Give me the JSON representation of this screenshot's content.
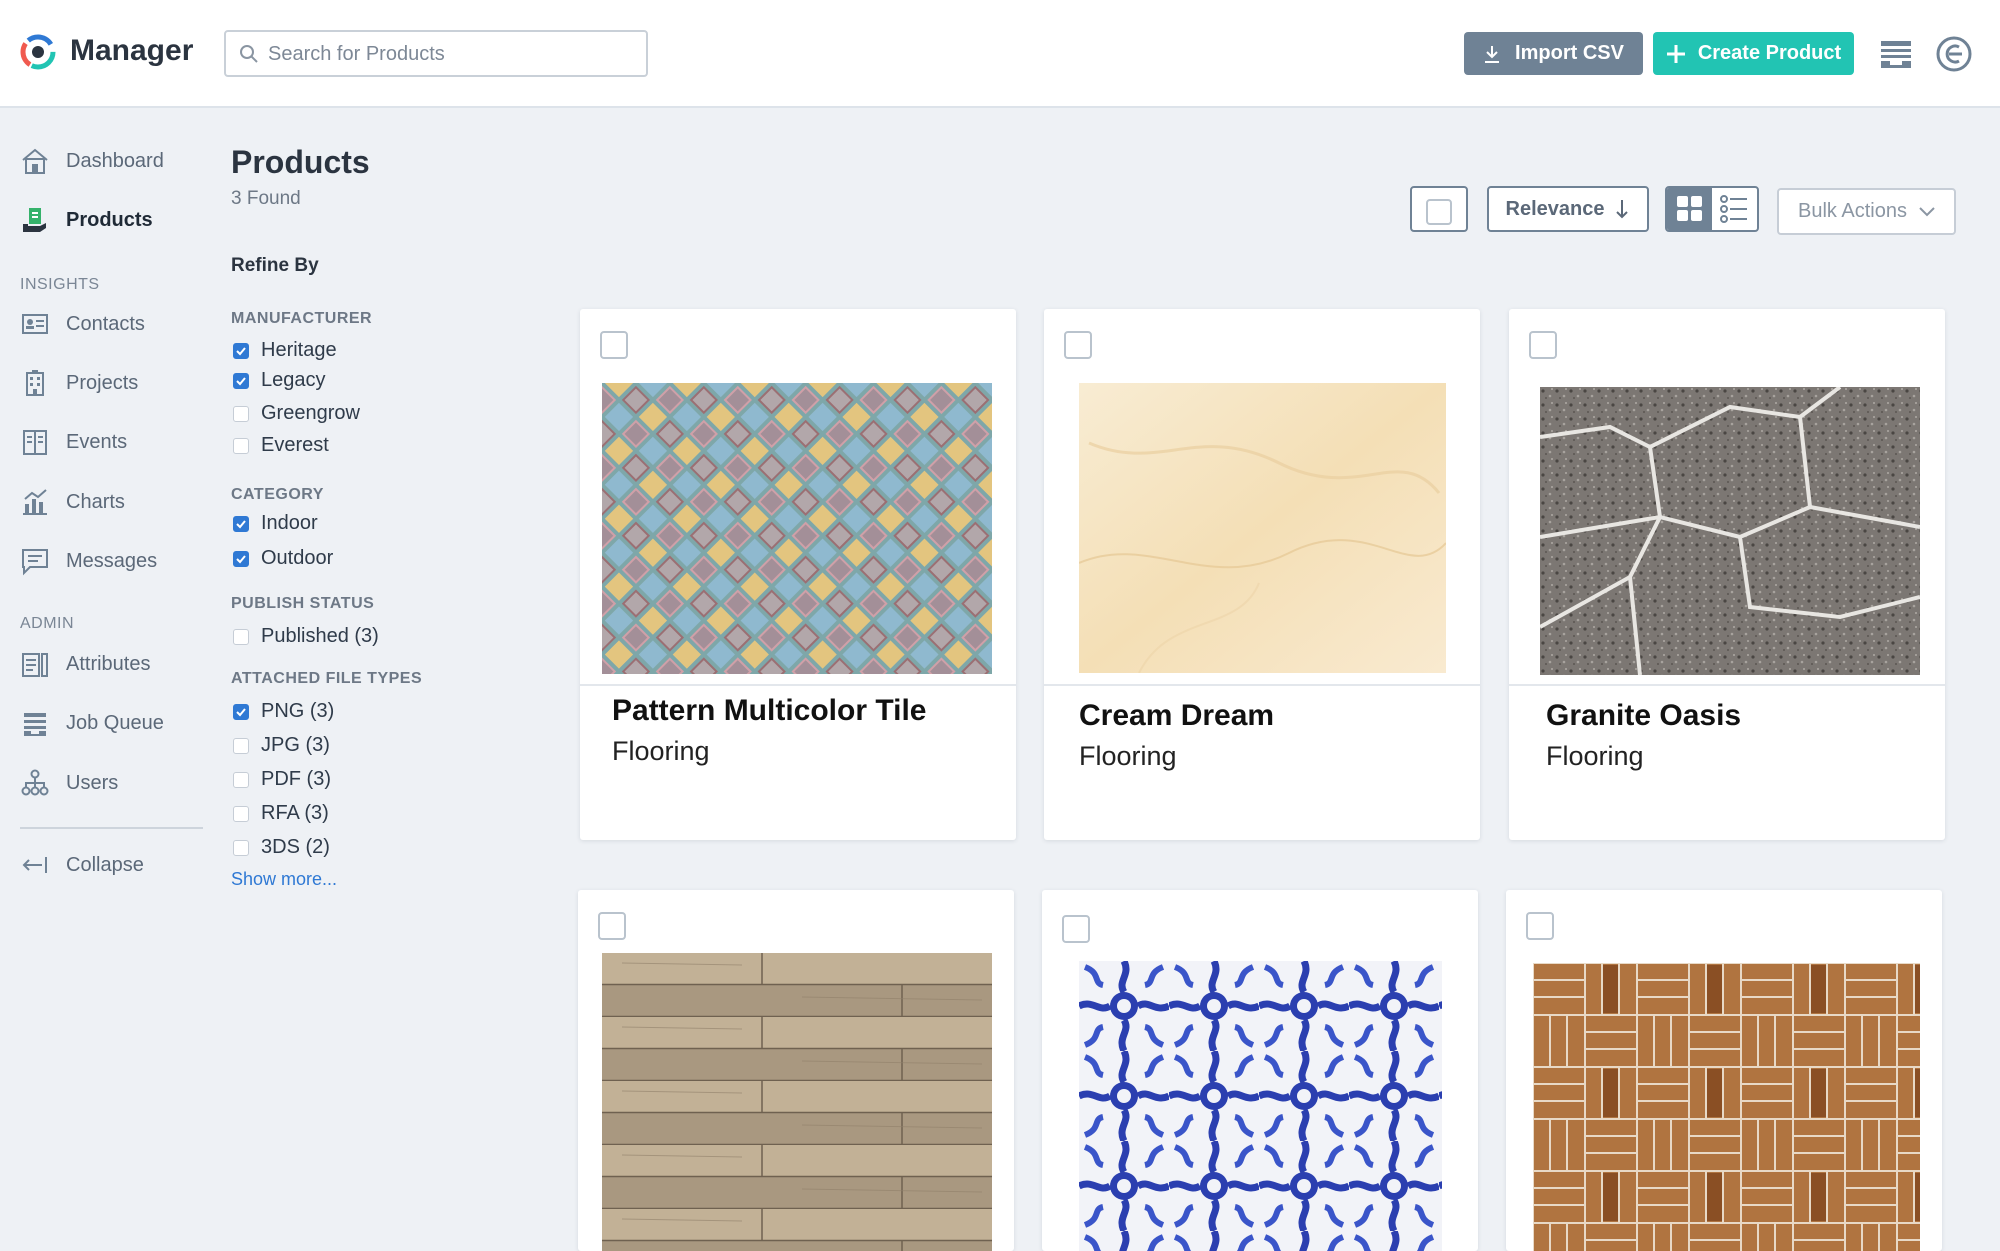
{
  "app": {
    "title": "Manager"
  },
  "search": {
    "placeholder": "Search for Products",
    "value": ""
  },
  "header": {
    "import_label": "Import CSV",
    "create_label": "Create Product"
  },
  "sidebar": {
    "items": [
      {
        "label": "Dashboard",
        "icon": "house-icon",
        "active": false
      },
      {
        "label": "Products",
        "icon": "product-icon",
        "active": true
      }
    ],
    "insights_label": "INSIGHTS",
    "insights": [
      {
        "label": "Contacts",
        "icon": "contact-card-icon"
      },
      {
        "label": "Projects",
        "icon": "building-icon"
      },
      {
        "label": "Events",
        "icon": "calendar-book-icon"
      },
      {
        "label": "Charts",
        "icon": "bar-chart-icon"
      },
      {
        "label": "Messages",
        "icon": "message-icon"
      }
    ],
    "admin_label": "ADMIN",
    "admin": [
      {
        "label": "Attributes",
        "icon": "attributes-icon"
      },
      {
        "label": "Job Queue",
        "icon": "queue-icon"
      },
      {
        "label": "Users",
        "icon": "org-chart-icon"
      }
    ],
    "collapse_label": "Collapse"
  },
  "page": {
    "title": "Products",
    "found": "3 Found",
    "refine_label": "Refine By"
  },
  "filters": {
    "manufacturer": {
      "label": "MANUFACTURER",
      "options": [
        {
          "label": "Heritage",
          "checked": true
        },
        {
          "label": "Legacy",
          "checked": true
        },
        {
          "label": "Greengrow",
          "checked": false
        },
        {
          "label": "Everest",
          "checked": false
        }
      ]
    },
    "category": {
      "label": "CATEGORY",
      "options": [
        {
          "label": "Indoor",
          "checked": true
        },
        {
          "label": "Outdoor",
          "checked": true
        }
      ]
    },
    "publish_status": {
      "label": "PUBLISH STATUS",
      "options": [
        {
          "label": "Published (3)",
          "checked": false
        }
      ]
    },
    "file_types": {
      "label": "ATTACHED FILE TYPES",
      "options": [
        {
          "label": "PNG (3)",
          "checked": true
        },
        {
          "label": "JPG (3)",
          "checked": false
        },
        {
          "label": "PDF (3)",
          "checked": false
        },
        {
          "label": "RFA (3)",
          "checked": false
        },
        {
          "label": "3DS (2)",
          "checked": false
        }
      ]
    },
    "show_more": "Show more..."
  },
  "toolbar": {
    "sort_label": "Relevance",
    "bulk_label": "Bulk Actions",
    "view_mode": "grid"
  },
  "products": [
    {
      "name": "Pattern Multicolor Tile",
      "category": "Flooring",
      "texture": "multicolor-scale-tiles"
    },
    {
      "name": "Cream Dream",
      "category": "Flooring",
      "texture": "cream-marble"
    },
    {
      "name": "Granite Oasis",
      "category": "Flooring",
      "texture": "cracked-granite"
    },
    {
      "name": "",
      "category": "",
      "texture": "weathered-wood-planks"
    },
    {
      "name": "",
      "category": "",
      "texture": "blue-white-azulejo"
    },
    {
      "name": "",
      "category": "",
      "texture": "basketweave-parquet"
    }
  ],
  "colors": {
    "accent": "#22c4b3",
    "import_button": "#6f8295",
    "link": "#2f79d4",
    "background": "#eef1f5"
  }
}
